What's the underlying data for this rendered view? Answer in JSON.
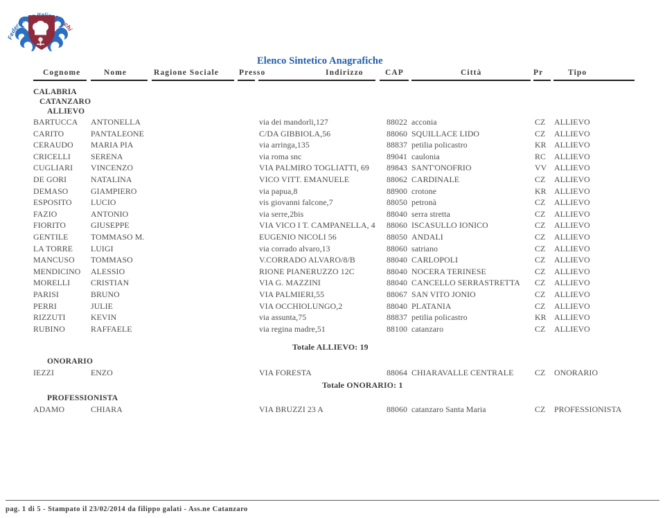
{
  "logo": {
    "alt_text": "Federazione Italiana Cuochi",
    "arc_text_left": "Federazione Italiana",
    "arc_text_right": "Cuochi",
    "shield_color": "#8e2a3c",
    "scroll_color": "#2a6fc0"
  },
  "report": {
    "title": "Elenco Sintetico Anagrafiche"
  },
  "columns": [
    {
      "key": "cognome",
      "label": "Cognome"
    },
    {
      "key": "nome",
      "label": "Nome"
    },
    {
      "key": "ragione_sociale",
      "label": "Ragione Sociale"
    },
    {
      "key": "presso",
      "label": "Presso"
    },
    {
      "key": "indirizzo",
      "label": "Indirizzo"
    },
    {
      "key": "cap",
      "label": "CAP"
    },
    {
      "key": "citta",
      "label": "Città"
    },
    {
      "key": "pr",
      "label": "Pr"
    },
    {
      "key": "tipo",
      "label": "Tipo"
    }
  ],
  "groups": {
    "region": "CALABRIA",
    "province": "CATANZARO",
    "section_allievo": "ALLIEVO",
    "section_onorario": "ONORARIO",
    "section_professionista": "PROFESSIONISTA"
  },
  "rows_allievo": [
    {
      "cognome": "BARTUCCA",
      "nome": "ANTONELLA",
      "ragione_sociale": "",
      "presso": "",
      "indirizzo": "via dei mandorli,127",
      "cap": "88022",
      "citta": "acconia",
      "pr": "CZ",
      "tipo": "ALLIEVO"
    },
    {
      "cognome": "CARITO",
      "nome": "PANTALEONE",
      "ragione_sociale": "",
      "presso": "",
      "indirizzo": "C/DA GIBBIOLA,56",
      "cap": "88060",
      "citta": "SQUILLACE LIDO",
      "pr": "CZ",
      "tipo": "ALLIEVO"
    },
    {
      "cognome": "CERAUDO",
      "nome": "MARIA PIA",
      "ragione_sociale": "",
      "presso": "",
      "indirizzo": "via arringa,135",
      "cap": "88837",
      "citta": "petilia policastro",
      "pr": "KR",
      "tipo": "ALLIEVO"
    },
    {
      "cognome": "CRICELLI",
      "nome": "SERENA",
      "ragione_sociale": "",
      "presso": "",
      "indirizzo": "via roma snc",
      "cap": "89041",
      "citta": "caulonia",
      "pr": "RC",
      "tipo": "ALLIEVO"
    },
    {
      "cognome": "CUGLIARI",
      "nome": "VINCENZO",
      "ragione_sociale": "",
      "presso": "",
      "indirizzo": "VIA PALMIRO TOGLIATTI, 69",
      "cap": "89843",
      "citta": "SANT'ONOFRIO",
      "pr": "VV",
      "tipo": "ALLIEVO"
    },
    {
      "cognome": "DE GORI",
      "nome": "NATALINA",
      "ragione_sociale": "",
      "presso": "",
      "indirizzo": "VICO VITT. EMANUELE",
      "cap": "88062",
      "citta": "CARDINALE",
      "pr": "CZ",
      "tipo": "ALLIEVO"
    },
    {
      "cognome": "DEMASO",
      "nome": "GIAMPIERO",
      "ragione_sociale": "",
      "presso": "",
      "indirizzo": "via papua,8",
      "cap": "88900",
      "citta": "crotone",
      "pr": "KR",
      "tipo": "ALLIEVO"
    },
    {
      "cognome": "ESPOSITO",
      "nome": "LUCIO",
      "ragione_sociale": "",
      "presso": "",
      "indirizzo": "vis giovanni falcone,7",
      "cap": "88050",
      "citta": "petronà",
      "pr": "CZ",
      "tipo": "ALLIEVO"
    },
    {
      "cognome": "FAZIO",
      "nome": "ANTONIO",
      "ragione_sociale": "",
      "presso": "",
      "indirizzo": "via serre,2bis",
      "cap": "88040",
      "citta": "serra stretta",
      "pr": "CZ",
      "tipo": "ALLIEVO"
    },
    {
      "cognome": "FIORITO",
      "nome": "GIUSEPPE",
      "ragione_sociale": "",
      "presso": "",
      "indirizzo": "VIA VICO I T. CAMPANELLA, 4",
      "cap": "88060",
      "citta": "ISCASULLO IONICO",
      "pr": "CZ",
      "tipo": "ALLIEVO"
    },
    {
      "cognome": "GENTILE",
      "nome": "TOMMASO M.",
      "ragione_sociale": "",
      "presso": "",
      "indirizzo": "EUGENIO NICOLI 56",
      "cap": "88050",
      "citta": "ANDALI",
      "pr": "CZ",
      "tipo": "ALLIEVO"
    },
    {
      "cognome": "LA TORRE",
      "nome": "LUIGI",
      "ragione_sociale": "",
      "presso": "",
      "indirizzo": "via corrado alvaro,13",
      "cap": "88060",
      "citta": "satriano",
      "pr": "CZ",
      "tipo": "ALLIEVO"
    },
    {
      "cognome": "MANCUSO",
      "nome": "TOMMASO",
      "ragione_sociale": "",
      "presso": "",
      "indirizzo": "V.CORRADO ALVARO/8/B",
      "cap": "88040",
      "citta": "CARLOPOLI",
      "pr": "CZ",
      "tipo": "ALLIEVO"
    },
    {
      "cognome": "MENDICINO",
      "nome": "ALESSIO",
      "ragione_sociale": "",
      "presso": "",
      "indirizzo": "RIONE PIANERUZZO 12C",
      "cap": "88040",
      "citta": "NOCERA TERINESE",
      "pr": "CZ",
      "tipo": "ALLIEVO"
    },
    {
      "cognome": "MORELLI",
      "nome": "CRISTIAN",
      "ragione_sociale": "",
      "presso": "",
      "indirizzo": "VIA G. MAZZINI",
      "cap": "88040",
      "citta": "CANCELLO SERRASTRETTA",
      "pr": "CZ",
      "tipo": "ALLIEVO"
    },
    {
      "cognome": "PARISI",
      "nome": "BRUNO",
      "ragione_sociale": "",
      "presso": "",
      "indirizzo": "VIA PALMIERI,55",
      "cap": "88067",
      "citta": "SAN VITO JONIO",
      "pr": "CZ",
      "tipo": "ALLIEVO"
    },
    {
      "cognome": "PERRI",
      "nome": "JULIE",
      "ragione_sociale": "",
      "presso": "",
      "indirizzo": "VIA OCCHIOLUNGO,2",
      "cap": "88040",
      "citta": "PLATANIA",
      "pr": "CZ",
      "tipo": "ALLIEVO"
    },
    {
      "cognome": "RIZZUTI",
      "nome": "KEVIN",
      "ragione_sociale": "",
      "presso": "",
      "indirizzo": "via assunta,75",
      "cap": "88837",
      "citta": "petilia policastro",
      "pr": "KR",
      "tipo": "ALLIEVO"
    },
    {
      "cognome": "RUBINO",
      "nome": "RAFFAELE",
      "ragione_sociale": "",
      "presso": "",
      "indirizzo": "via regina madre,51",
      "cap": "88100",
      "citta": "catanzaro",
      "pr": "CZ",
      "tipo": "ALLIEVO"
    }
  ],
  "total_allievo": "Totale ALLIEVO: 19",
  "rows_onorario": [
    {
      "cognome": "IEZZI",
      "nome": "ENZO",
      "ragione_sociale": "",
      "presso": "",
      "indirizzo": "VIA FORESTA",
      "cap": "88064",
      "citta": "CHIARAVALLE CENTRALE",
      "pr": "CZ",
      "tipo": "ONORARIO"
    }
  ],
  "total_onorario": "Totale ONORARIO: 1",
  "rows_professionista": [
    {
      "cognome": "ADAMO",
      "nome": "CHIARA",
      "ragione_sociale": "",
      "presso": "",
      "indirizzo": "VIA BRUZZI 23 A",
      "cap": "88060",
      "citta": "catanzaro Santa Maria",
      "pr": "CZ",
      "tipo": "PROFESSIONISTA"
    }
  ],
  "footer": {
    "text": "pag. 1 di 5 - Stampato il 23/02/2014 da filippo galati - Ass.ne Catanzaro"
  }
}
